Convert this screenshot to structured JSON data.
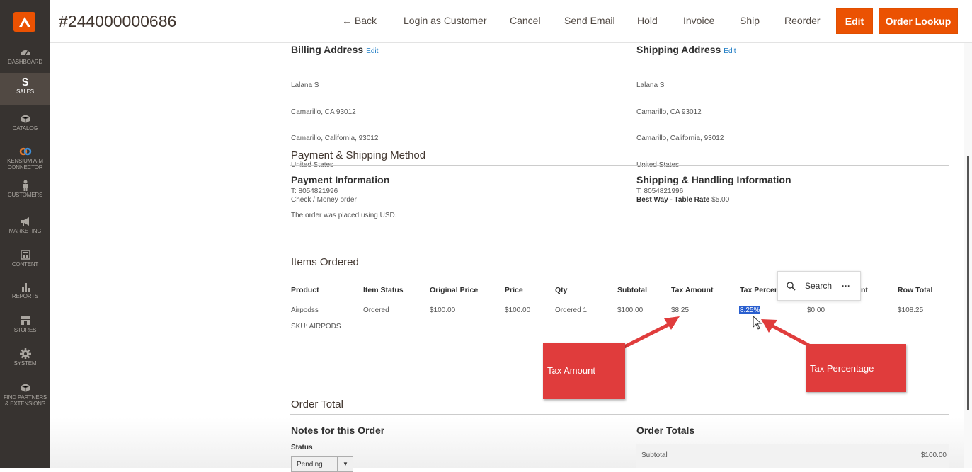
{
  "sidebar": {
    "items": [
      {
        "label": "DASHBOARD",
        "icon": "speedometer-icon"
      },
      {
        "label": "SALES",
        "icon": "dollar-icon",
        "active": true,
        "symbol": "$"
      },
      {
        "label": "CATALOG",
        "icon": "cube-icon"
      },
      {
        "label": "KENSIUM A-M CONNECTOR",
        "icon": "infinity-icon"
      },
      {
        "label": "CUSTOMERS",
        "icon": "person-icon"
      },
      {
        "label": "MARKETING",
        "icon": "megaphone-icon"
      },
      {
        "label": "CONTENT",
        "icon": "layout-icon"
      },
      {
        "label": "REPORTS",
        "icon": "bar-chart-icon"
      },
      {
        "label": "STORES",
        "icon": "storefront-icon"
      },
      {
        "label": "SYSTEM",
        "icon": "gear-icon"
      },
      {
        "label": "FIND PARTNERS & EXTENSIONS",
        "icon": "box-icon"
      }
    ]
  },
  "header": {
    "order_number": "#244000000686",
    "actions": {
      "back": "← Back",
      "login_as_customer": "Login as Customer",
      "cancel": "Cancel",
      "send_email": "Send Email",
      "hold": "Hold",
      "invoice": "Invoice",
      "ship": "Ship",
      "reorder": "Reorder",
      "edit": "Edit",
      "order_lookup": "Order Lookup"
    }
  },
  "addresses": {
    "billing": {
      "title": "Billing Address",
      "edit": "Edit",
      "lines": [
        "Lalana S",
        "Camarillo, CA 93012",
        "Camarillo, California, 93012",
        "United States",
        "T: 8054821996"
      ]
    },
    "shipping": {
      "title": "Shipping Address",
      "edit": "Edit",
      "lines": [
        "Lalana S",
        "Camarillo, CA 93012",
        "Camarillo, California, 93012",
        "United States",
        "T: 8054821996"
      ]
    }
  },
  "payment_shipping": {
    "section_title": "Payment & Shipping Method",
    "payment_title": "Payment Information",
    "payment_method": "Check / Money order",
    "payment_note": "The order was placed using USD.",
    "shipping_title": "Shipping & Handling Information",
    "shipping_method": "Best Way - Table Rate",
    "shipping_price": "$5.00"
  },
  "items_ordered": {
    "section_title": "Items Ordered",
    "columns": [
      "Product",
      "Item Status",
      "Original Price",
      "Price",
      "Qty",
      "Subtotal",
      "Tax Amount",
      "Tax Percen",
      "nt",
      "Row Total"
    ],
    "rows": [
      {
        "product": "Airpodss",
        "sku": "SKU: AIRPODS",
        "item_status": "Ordered",
        "original_price": "$100.00",
        "price": "$100.00",
        "qty": "Ordered 1",
        "subtotal": "$100.00",
        "tax_amount": "$8.25",
        "tax_percent": "8.25%",
        "discount": "$0.00",
        "row_total": "$108.25"
      }
    ]
  },
  "search_popup": {
    "label": "Search",
    "more": "···"
  },
  "callouts": {
    "tax_amount": "Tax Amount",
    "tax_percentage": "Tax Percentage",
    "color": "#e03c3c"
  },
  "order_total": {
    "section_title": "Order Total",
    "notes_title": "Notes for this Order",
    "status_label": "Status",
    "status_value": "Pending",
    "totals_title": "Order Totals",
    "subtotal_label": "Subtotal",
    "subtotal_value": "$100.00"
  },
  "colors": {
    "accent": "#eb5202",
    "sidebar": "#373330",
    "link": "#1979c3"
  }
}
